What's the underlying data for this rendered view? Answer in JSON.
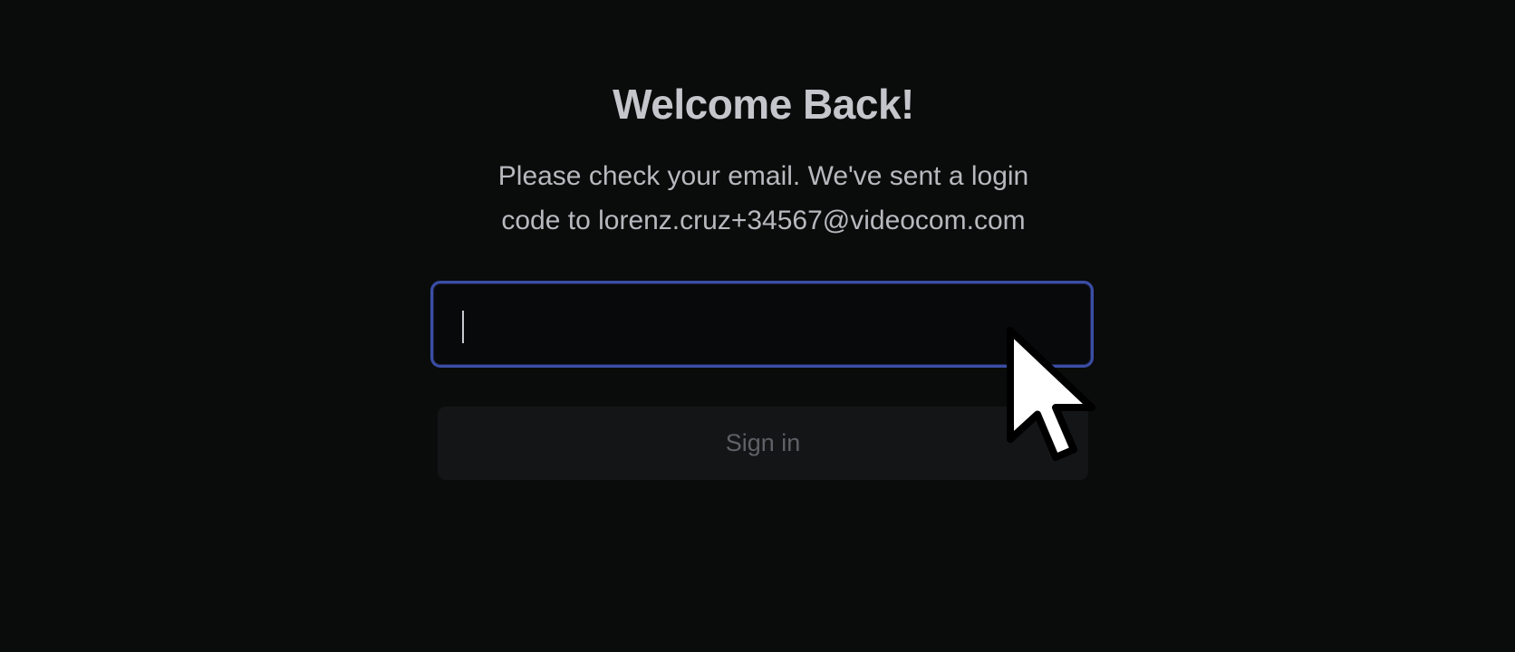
{
  "login": {
    "title": "Welcome Back!",
    "message_line1": "Please check your email. We've sent a login",
    "message_line2": "code to lorenz.cruz+34567@videocom.com",
    "code_input": {
      "value": "",
      "placeholder": ""
    },
    "signin_label": "Sign in"
  },
  "colors": {
    "background": "#0a0b0b",
    "focus_ring": "#3a4ea6",
    "button_bg": "#141517"
  },
  "icons": {
    "cursor": "mouse-pointer-icon"
  }
}
